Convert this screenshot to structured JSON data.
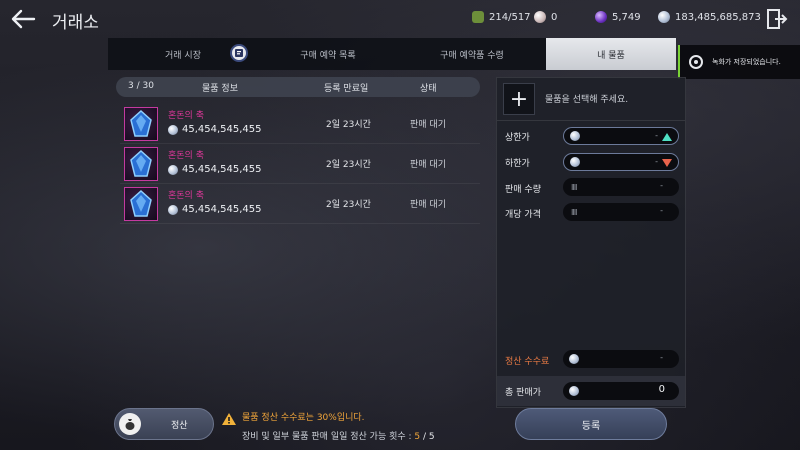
{
  "header": {
    "title": "거래소",
    "back_icon": "arrow-left-icon",
    "exit_icon": "exit-door-icon"
  },
  "resources": {
    "capacity": "214/517",
    "silver_small": "0",
    "purple_gem": "5,749",
    "silver": "183,485,685,873"
  },
  "tabs": [
    {
      "label": "거래 시장",
      "active": false
    },
    {
      "label": "구매 예약 목록",
      "active": false
    },
    {
      "label": "구매 예약품 수령",
      "active": false
    },
    {
      "label": "내 물품",
      "active": true
    }
  ],
  "notification": {
    "text": "녹화가 저장되었습니다."
  },
  "list": {
    "count": "3 / 30",
    "columns": {
      "info": "물품 정보",
      "expiry": "등록 만료일",
      "status": "상태"
    },
    "rows": [
      {
        "name": "혼돈의 축",
        "price": "45,454,545,455",
        "expiry": "2일 23시간",
        "status": "판매 대기"
      },
      {
        "name": "혼돈의 축",
        "price": "45,454,545,455",
        "expiry": "2일 23시간",
        "status": "판매 대기"
      },
      {
        "name": "혼돈의 축",
        "price": "45,454,545,455",
        "expiry": "2일 23시간",
        "status": "판매 대기"
      }
    ]
  },
  "panel": {
    "add_symbol": "+",
    "select_hint": "물품을 선택해 주세요.",
    "upper_label": "상한가",
    "upper_value": "-",
    "lower_label": "하한가",
    "lower_value": "-",
    "qty_label": "판매 수량",
    "qty_bars": "IIII",
    "qty_value": "-",
    "unit_label": "개당 가격",
    "unit_bars": "IIII",
    "unit_value": "-",
    "fee_label": "정산 수수료",
    "fee_value": "-",
    "total_label": "총 판매가",
    "total_value": "0"
  },
  "footer": {
    "settle_label": "정산",
    "notice_line1": "물품 정산 수수료는 30%입니다.",
    "notice_line2_prefix": "장비 및 일부 물품 판매 일일 정산 가능 횟수 : ",
    "count_current": "5",
    "count_sep": " / ",
    "count_max": "5",
    "register_label": "등록"
  },
  "colors": {
    "accent_active_tab": "#d4d7dc",
    "item_name": "#e0379a",
    "warning": "#f2a63a",
    "fee_label": "#e87a44",
    "notice_bar": "#7ad236",
    "upper_arrow": "#4fe0c4",
    "lower_arrow": "#e8634c"
  }
}
